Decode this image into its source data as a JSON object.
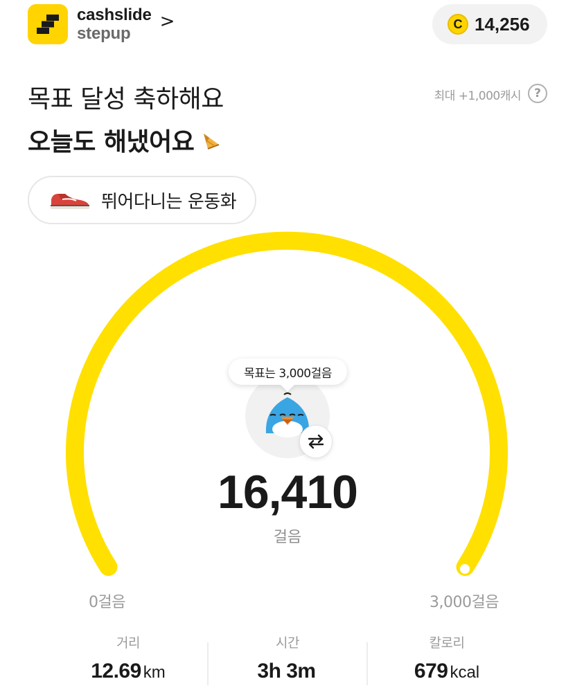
{
  "header": {
    "brand_line1": "cashslide",
    "brand_line2": "stepup",
    "chevron": ">",
    "coin_symbol": "C",
    "cash_amount": "14,256"
  },
  "titles": {
    "line1": "목표 달성 축하해요",
    "line2": "오늘도 해냈어요"
  },
  "max_reward": "최대 +1,000캐시",
  "help_symbol": "?",
  "shoe": {
    "label": "뛰어다니는 운동화"
  },
  "gauge": {
    "goal_tooltip": "목표는 3,000걸음",
    "steps": "16,410",
    "steps_unit": "걸음",
    "range_min": "0걸음",
    "range_max": "3,000걸음",
    "progress": 1.0,
    "color": "#ffe000"
  },
  "stats": [
    {
      "label": "거리",
      "value": "12.69",
      "unit": "km"
    },
    {
      "label": "시간",
      "value": "3h 3m",
      "unit": ""
    },
    {
      "label": "칼로리",
      "value": "679",
      "unit": "kcal"
    }
  ],
  "icons": {
    "logo": "cashslide-logo-icon",
    "coin": "coin-icon",
    "celebrate": "party-horn-icon",
    "shoe": "sneaker-icon",
    "character": "penguin-character-icon",
    "swap": "swap-arrows-icon",
    "help": "question-icon"
  }
}
